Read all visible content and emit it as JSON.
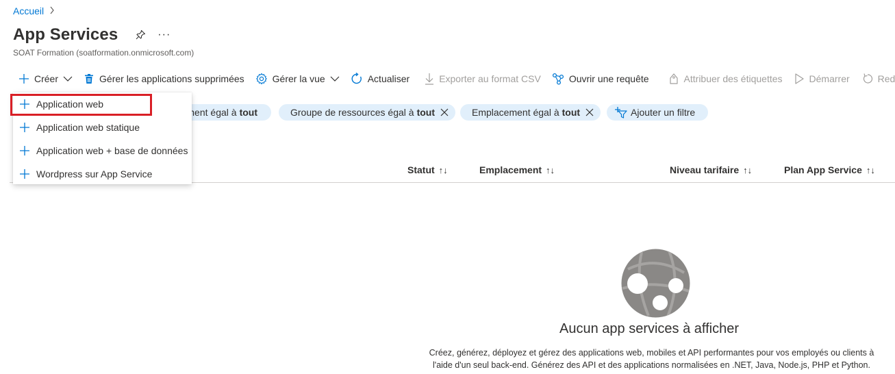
{
  "breadcrumb": {
    "home": "Accueil",
    "separator": ">"
  },
  "header": {
    "title": "App Services",
    "subtitle": "SOAT Formation (soatformation.onmicrosoft.com)",
    "more": "···"
  },
  "toolbar": {
    "create": "Créer",
    "manage_deleted": "Gérer les applications supprimées",
    "manage_view": "Gérer la vue",
    "refresh": "Actualiser",
    "export_csv": "Exporter au format CSV",
    "open_query": "Ouvrir une requête",
    "assign_tags": "Attribuer des étiquettes",
    "start": "Démarrer",
    "restart": "Red"
  },
  "filters": [
    {
      "label": "ment égal à",
      "value": "tout"
    },
    {
      "label": "Groupe de ressources égal à",
      "value": "tout"
    },
    {
      "label": "Emplacement égal à",
      "value": "tout"
    }
  ],
  "add_filter": "Ajouter un filtre",
  "columns": {
    "status": "Statut",
    "location": "Emplacement",
    "pricing_tier": "Niveau tarifaire",
    "app_service_plan": "Plan App Service",
    "sort_glyph": "↑↓"
  },
  "create_menu": {
    "items": [
      "Application web",
      "Application web statique",
      "Application web + base de données",
      "Wordpress sur App Service"
    ]
  },
  "empty_state": {
    "title": "Aucun app services à afficher",
    "line1": "Créez, générez, déployez et gérez des applications web, mobiles et API performantes pour vos employés ou clients à",
    "line2": "l'aide d'un seul back-end. Générez des API et des applications normalisées en .NET, Java, Node.js, PHP et Python."
  },
  "colors": {
    "accent": "#0078d4",
    "pill_bg": "#e1effb",
    "highlight": "#d91f26"
  }
}
